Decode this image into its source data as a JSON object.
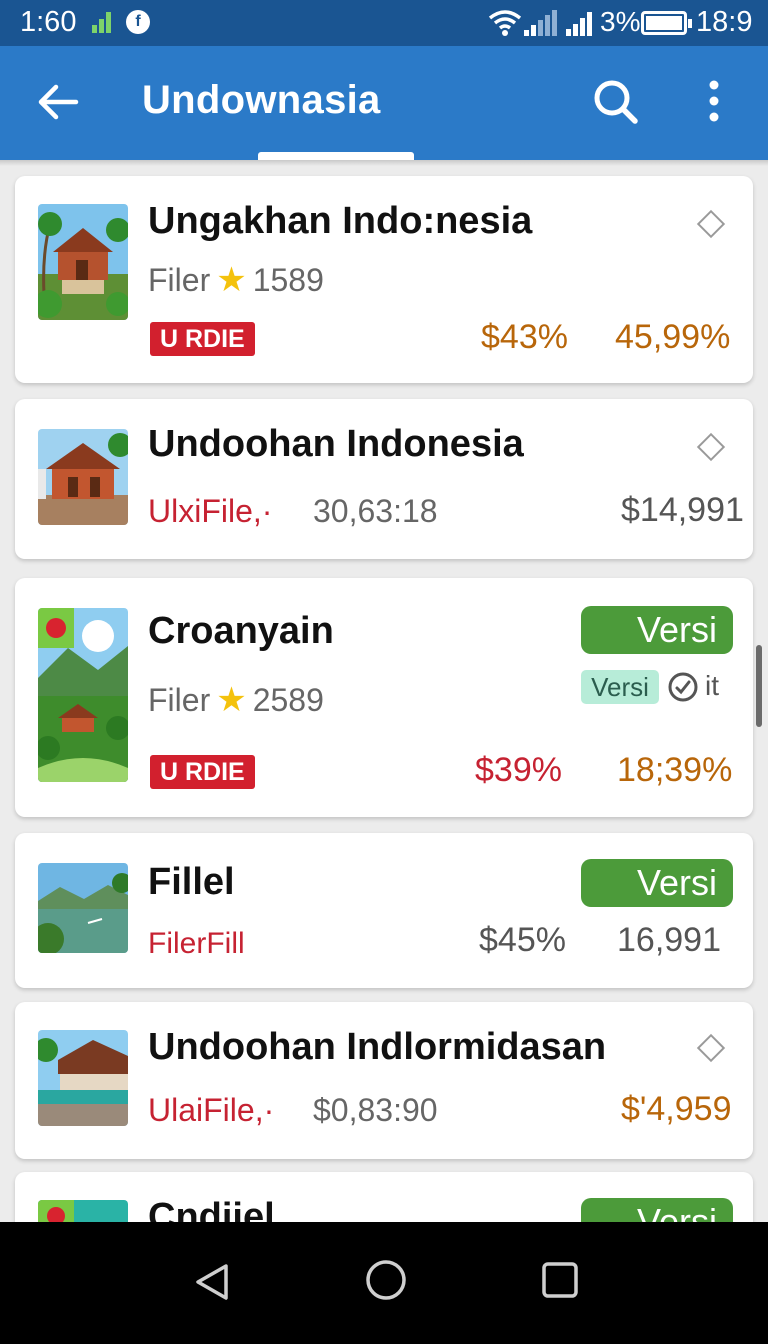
{
  "status_bar": {
    "time_left": "1:60",
    "app_badge": "f",
    "battery_pct": "3%",
    "time_right": "18:9"
  },
  "app_bar": {
    "title": "Undownasia"
  },
  "colors": {
    "status_bar": "#1a5592",
    "app_bar": "#2b7ac8",
    "tag_red": "#d2202e",
    "price_gold": "#b8660a",
    "price_red": "#c62232",
    "versi_green": "#4c9b3a",
    "chip_mint": "#b7ecd8"
  },
  "cards": [
    {
      "title": "Ungakhan Indo:nesia",
      "sub_label": "Filer",
      "rating_count": "1589",
      "tag": "U RDIE",
      "price_left": "$43%",
      "price_right": "45,99%",
      "icon": "diamond-icon"
    },
    {
      "title": "Undoohan Indonesia",
      "sub_label": "UlxiFile,·",
      "meta": "30,63:18",
      "price_right": "$14,991",
      "icon": "diamond-icon"
    },
    {
      "title": "Croanyain",
      "sub_label": "Filer",
      "rating_count": "2589",
      "tag": "U RDIE",
      "price_left": "$39%",
      "price_right": "18;39%",
      "button": "Versi",
      "chip": "Versi",
      "check_label": "it"
    },
    {
      "title": "Fillel",
      "sub_label": "FilerFill",
      "price_left": "$45%",
      "price_right": "16,991",
      "button": "Versi"
    },
    {
      "title": "Undoohan Indlormidasan",
      "sub_label": "UlaiFile,·",
      "meta": "$0,83:90",
      "price_right": "$'4,959",
      "icon": "diamond-icon"
    },
    {
      "title": "Cndiiel",
      "button": "Versi"
    }
  ]
}
